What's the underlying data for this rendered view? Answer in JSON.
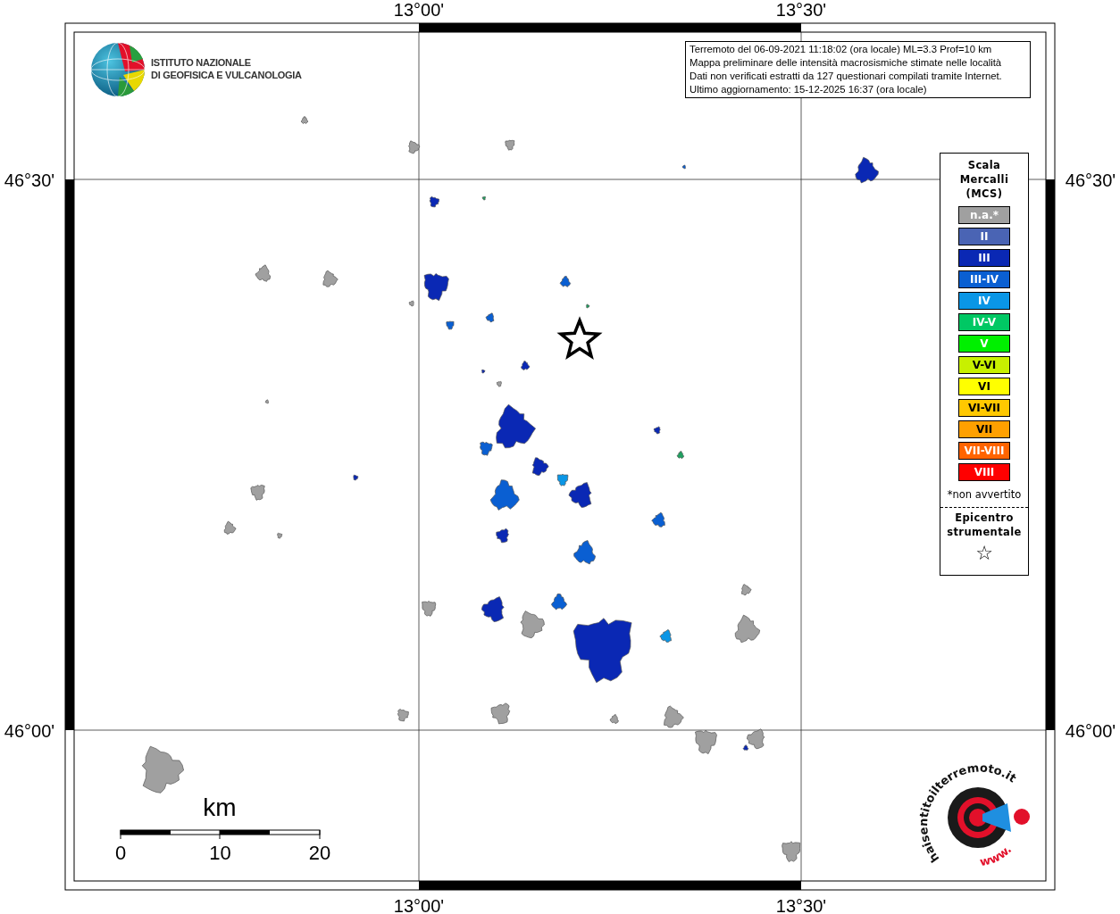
{
  "axes": {
    "top": [
      "13°00'",
      "13°30'"
    ],
    "bottom": [
      "13°00'",
      "13°30'"
    ],
    "left": [
      "46°30'",
      "46°00'"
    ],
    "right": [
      "46°30'",
      "46°00'"
    ]
  },
  "institute_logo": {
    "lines": [
      "ISTITUTO NAZIONALE",
      "DI GEOFISICA E VULCANOLOGIA"
    ]
  },
  "info_box": {
    "lines": [
      "Terremoto del 06-09-2021 11:18:02 (ora locale) ML=3.3 Prof=10 km",
      "Mappa preliminare delle intensità macrosismiche stimate nelle località",
      "Dati non verificati estratti da 127 questionari compilati tramite Internet.",
      "Ultimo aggiornamento: 15-12-2025 16:37 (ora locale)"
    ]
  },
  "legend": {
    "title_lines": [
      "Scala",
      "Mercalli",
      "(MCS)"
    ],
    "classes": [
      {
        "label": "n.a.*",
        "color": "#a0a0a0"
      },
      {
        "label": "II",
        "color": "#4a64b4"
      },
      {
        "label": "III",
        "color": "#0a28b4"
      },
      {
        "label": "III-IV",
        "color": "#0a5fd2"
      },
      {
        "label": "IV",
        "color": "#0a96e6"
      },
      {
        "label": "IV-V",
        "color": "#00c864"
      },
      {
        "label": "V",
        "color": "#00f000"
      },
      {
        "label": "V-VI",
        "color": "#c8f000"
      },
      {
        "label": "VI",
        "color": "#ffff00"
      },
      {
        "label": "VI-VII",
        "color": "#ffc800"
      },
      {
        "label": "VII",
        "color": "#ffa000"
      },
      {
        "label": "VII-VIII",
        "color": "#ff6400"
      },
      {
        "label": "VIII",
        "color": "#ff0000"
      }
    ],
    "footnote": "*non avvertito",
    "epicentre_lines": [
      "Epicentro",
      "strumentale"
    ],
    "epicentre_symbol": "☆"
  },
  "scale_bar": {
    "unit": "km",
    "ticks": [
      "0",
      "10",
      "20"
    ]
  },
  "site_logo": {
    "arc_text": "haisentitoilterremoto.it",
    "bottom_text": "www."
  }
}
